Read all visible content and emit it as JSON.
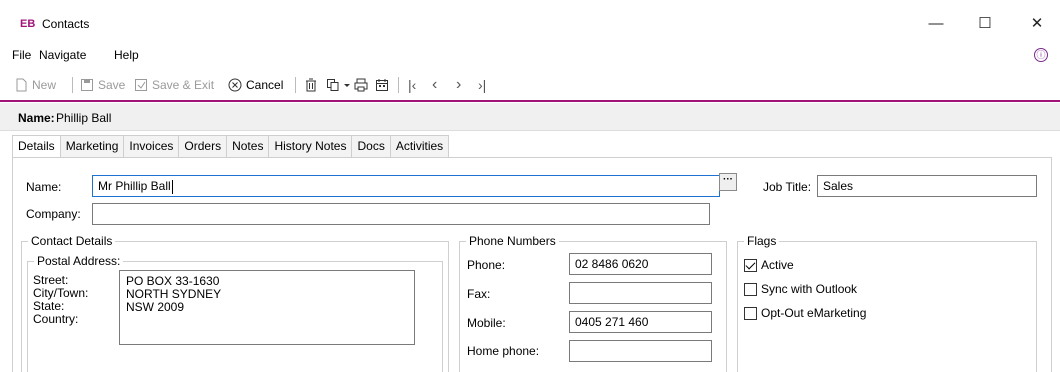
{
  "window": {
    "app_badge": "EB",
    "title": "Contacts",
    "minimize": "—",
    "maximize": "☐",
    "close": "✕"
  },
  "menu": {
    "file": "File",
    "navigate": "Navigate",
    "help": "Help",
    "info_icon": "ⓘ"
  },
  "toolbar": {
    "new": "New",
    "save": "Save",
    "save_exit": "Save & Exit",
    "cancel": "Cancel",
    "glyphs": {
      "first": "|‹",
      "prev": "‹",
      "next": "›",
      "last": "›|"
    }
  },
  "namebar": {
    "label": "Name:",
    "value": "Phillip Ball"
  },
  "tabs": [
    "Details",
    "Marketing",
    "Invoices",
    "Orders",
    "Notes",
    "History Notes",
    "Docs",
    "Activities"
  ],
  "details": {
    "name_label": "Name:",
    "name_value": "Mr Phillip  Ball",
    "ellipsis": "···",
    "job_title_label": "Job Title:",
    "job_title_value": "Sales",
    "company_label": "Company:",
    "company_value": ""
  },
  "contact_details": {
    "title": "Contact Details",
    "postal_title": "Postal Address:",
    "street_label": "Street:",
    "city_label": "City/Town:",
    "state_label": "State:",
    "country_label": "Country:",
    "street": "PO BOX 33-1630",
    "city": "NORTH SYDNEY",
    "state": "NSW 2009",
    "country": ""
  },
  "phone_numbers": {
    "title": "Phone Numbers",
    "phone_label": "Phone:",
    "phone_value": "02 8486 0620",
    "fax_label": "Fax:",
    "fax_value": "",
    "mobile_label": "Mobile:",
    "mobile_value": "0405 271 460",
    "home_label": "Home phone:",
    "home_value": ""
  },
  "flags": {
    "title": "Flags",
    "items": [
      {
        "label": "Active",
        "checked": true
      },
      {
        "label": "Sync with Outlook",
        "checked": false
      },
      {
        "label": "Opt-Out eMarketing",
        "checked": false
      }
    ]
  }
}
